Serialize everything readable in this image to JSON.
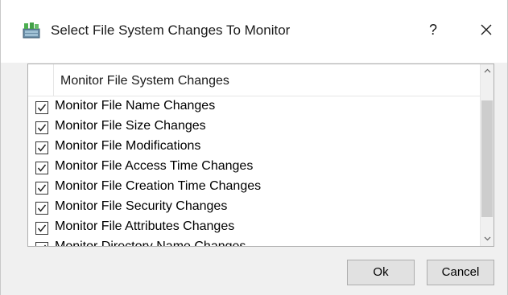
{
  "window": {
    "title": "Select File System Changes To Monitor",
    "help_label": "?",
    "close_label": "✕",
    "icon": "app-icon"
  },
  "list": {
    "header": "Monitor File System Changes",
    "items": [
      {
        "label": "Monitor File Name Changes",
        "checked": true
      },
      {
        "label": "Monitor File Size Changes",
        "checked": true
      },
      {
        "label": "Monitor File Modifications",
        "checked": true
      },
      {
        "label": "Monitor File Access Time Changes",
        "checked": true
      },
      {
        "label": "Monitor File Creation Time Changes",
        "checked": true
      },
      {
        "label": "Monitor File Security Changes",
        "checked": true
      },
      {
        "label": "Monitor File Attributes Changes",
        "checked": true
      },
      {
        "label": "Monitor Directory Name Changes",
        "checked": true
      }
    ],
    "scroll_position": 0.6
  },
  "buttons": {
    "ok_label": "Ok",
    "cancel_label": "Cancel"
  }
}
